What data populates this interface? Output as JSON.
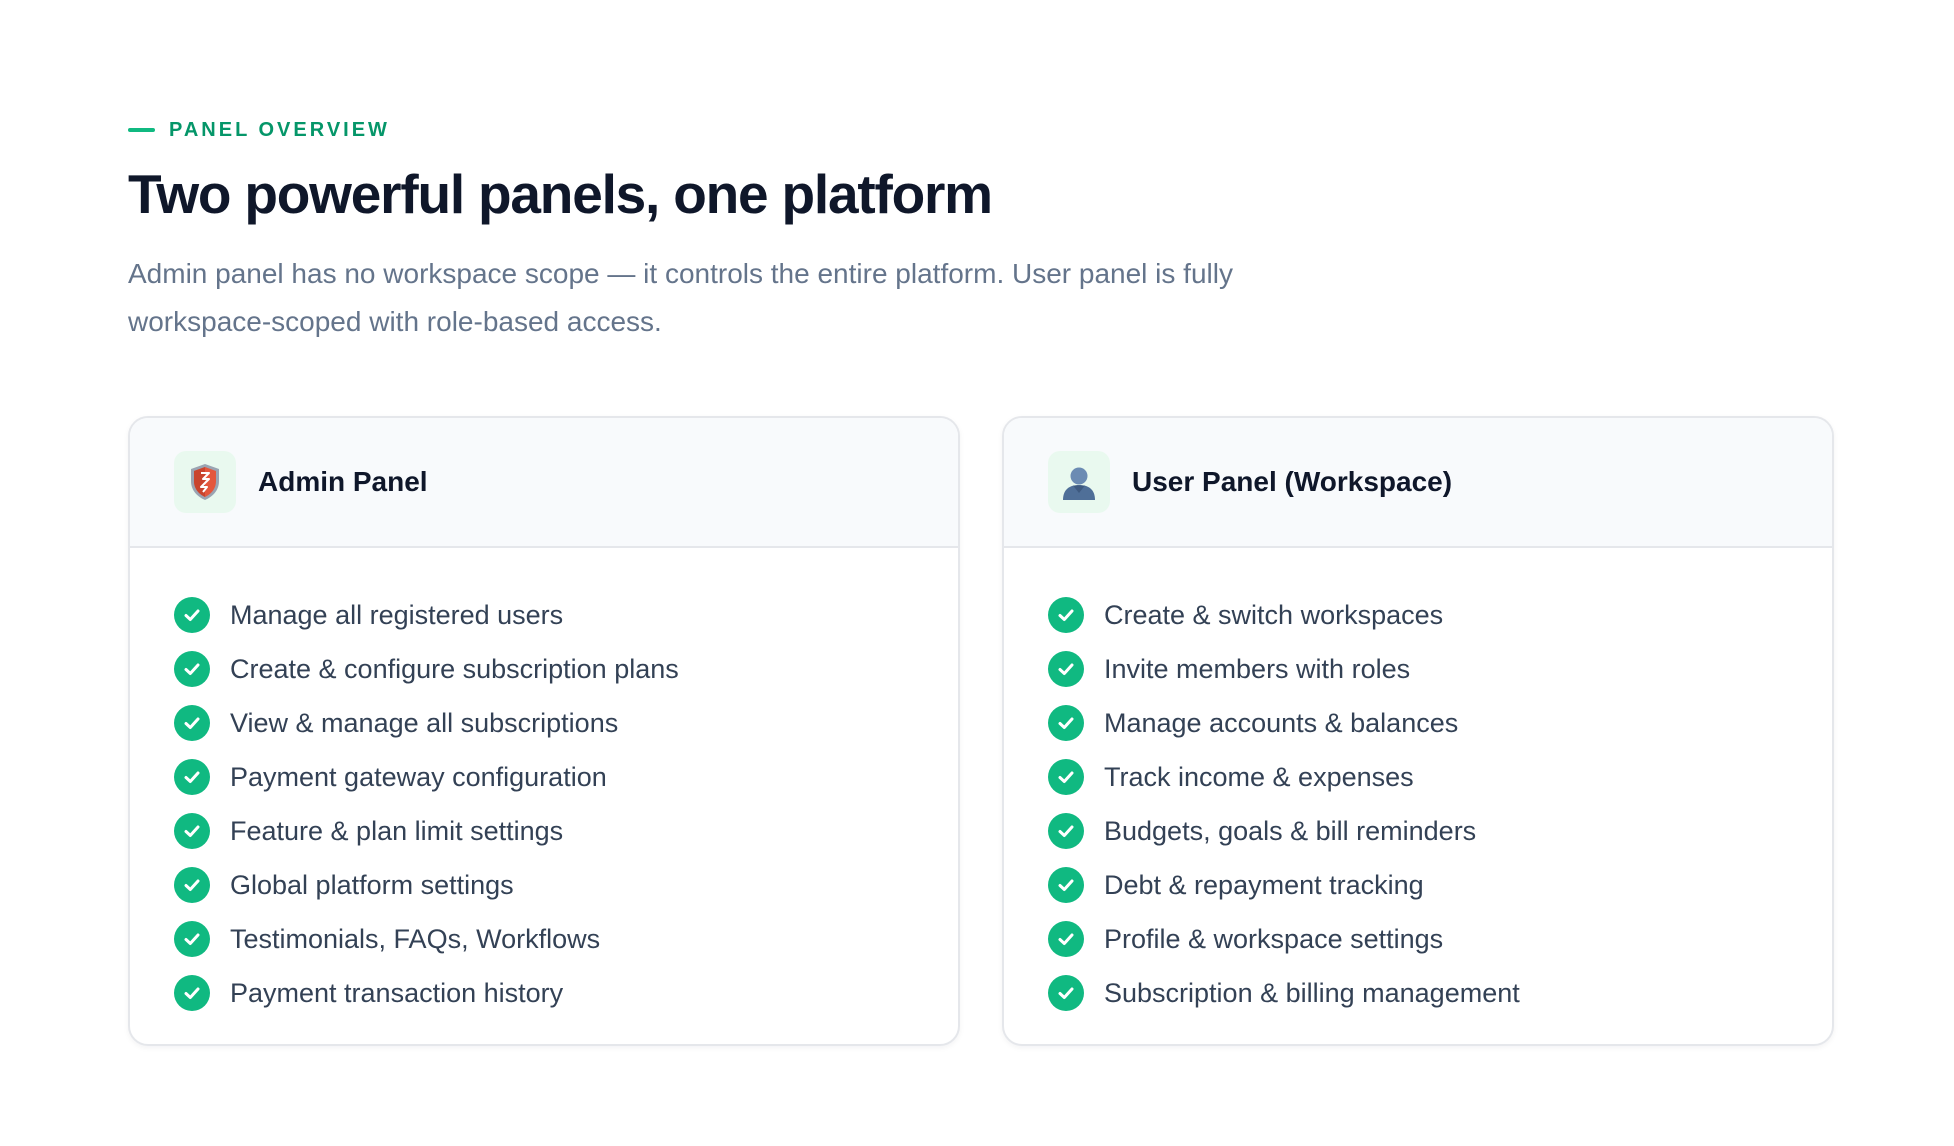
{
  "section": {
    "eyebrow": "PANEL OVERVIEW",
    "title": "Two powerful panels, one platform",
    "subtitle": "Admin panel has no workspace scope — it controls the entire platform. User panel is fully workspace-scoped with role-based access."
  },
  "colors": {
    "accent": "#10b981",
    "accent_dark": "#059669",
    "icon_bg": "#e9f9ef"
  },
  "panels": [
    {
      "title": "Admin Panel",
      "icon": "shield-icon",
      "items": [
        "Manage all registered users",
        "Create & configure subscription plans",
        "View & manage all subscriptions",
        "Payment gateway configuration",
        "Feature & plan limit settings",
        "Global platform settings",
        "Testimonials, FAQs, Workflows",
        "Payment transaction history"
      ]
    },
    {
      "title": "User Panel (Workspace)",
      "icon": "user-icon",
      "items": [
        "Create & switch workspaces",
        "Invite members with roles",
        "Manage accounts & balances",
        "Track income & expenses",
        "Budgets, goals & bill reminders",
        "Debt & repayment tracking",
        "Profile & workspace settings",
        "Subscription & billing management"
      ]
    }
  ]
}
